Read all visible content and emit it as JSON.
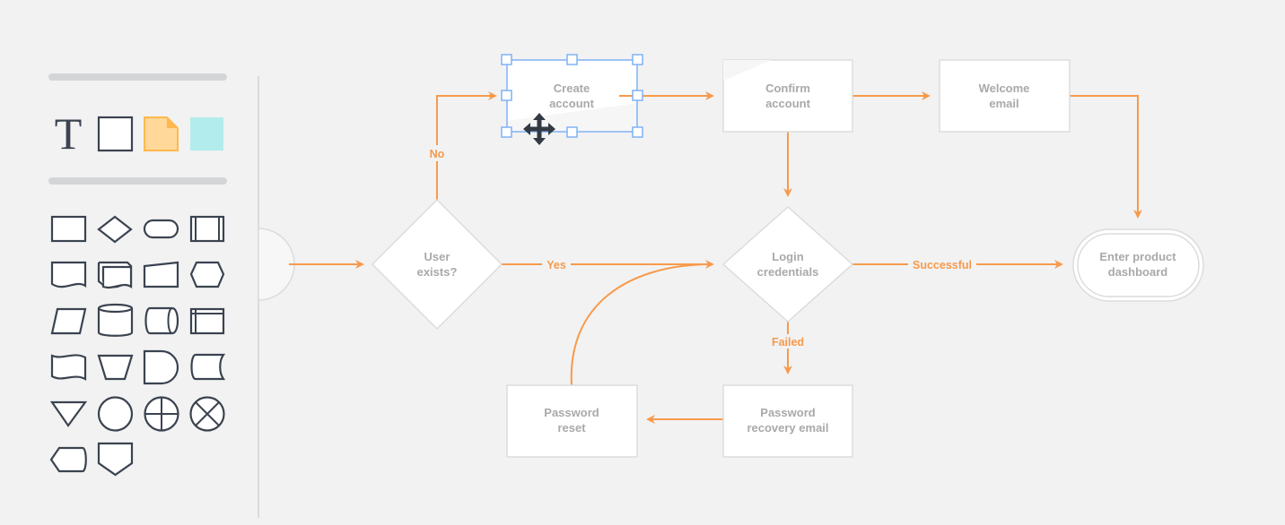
{
  "toolbar": {
    "top_tools": [
      "text-tool",
      "shape-tool",
      "sticky-note-tool",
      "color-block-tool"
    ],
    "sticky_color": "#ffd89a",
    "block_color": "#b2ecec",
    "shape_library": [
      "process",
      "decision",
      "terminator",
      "predefined-process",
      "document",
      "multiple-documents",
      "manual-input",
      "preparation",
      "data",
      "database",
      "direct-access-storage",
      "internal-storage",
      "tape",
      "manual-operation",
      "delay",
      "stored-data",
      "merge",
      "connector",
      "summing-junction",
      "or",
      "display",
      "off-page-reference"
    ]
  },
  "diagram": {
    "accent": "#f79a4c",
    "selection_color": "#7fb2f5",
    "nodes": {
      "user_exists": [
        "User",
        "exists?"
      ],
      "create_account": [
        "Create",
        "account"
      ],
      "confirm_account": [
        "Confirm",
        "account"
      ],
      "welcome_email": [
        "Welcome",
        "email"
      ],
      "login": [
        "Login",
        "credentials"
      ],
      "dashboard": [
        "Enter product",
        "dashboard"
      ],
      "recovery": [
        "Password",
        "recovery email"
      ],
      "reset": [
        "Password",
        "reset"
      ]
    },
    "edges": {
      "no": "No",
      "yes": "Yes",
      "successful": "Successful",
      "failed": "Failed"
    }
  }
}
